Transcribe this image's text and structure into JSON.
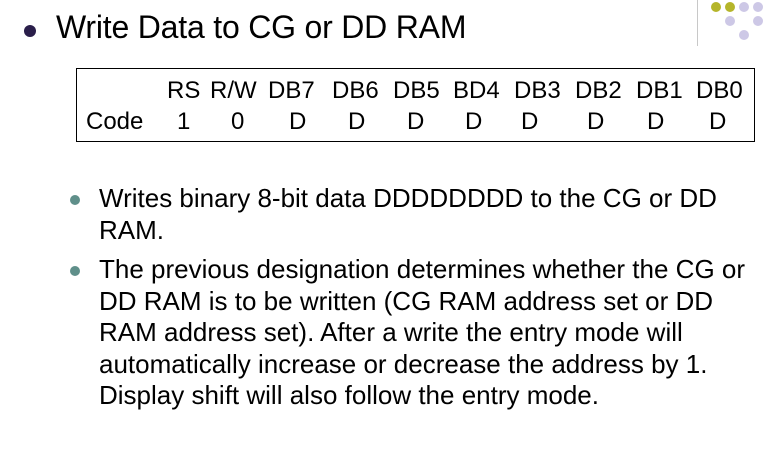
{
  "title": "Write Data to CG or DD RAM",
  "table": {
    "headers": [
      "RS",
      "R/W",
      "DB7",
      "DB6",
      "DB5",
      "BD4",
      "DB3",
      "DB2",
      "DB1",
      "DB0"
    ],
    "row_label": "Code",
    "values": [
      "1",
      "0",
      "D",
      "D",
      "D",
      "D",
      "D",
      "D",
      "D",
      "D"
    ]
  },
  "bullets": [
    "Writes binary 8-bit data DDDDDDDD to the CG or DD RAM.",
    "The previous designation determines whether the CG or DD RAM is to be written (CG RAM address set or DD RAM address set). After a write the entry mode will automatically increase or decrease the address by 1. Display shift will also follow the entry mode."
  ],
  "colors": {
    "title_bullet": "#2a1e4a",
    "list_bullet": "#5f8f8a",
    "decor_dot_olive": "#b5b52a",
    "decor_dot_lavender": "#cdc8e6"
  }
}
